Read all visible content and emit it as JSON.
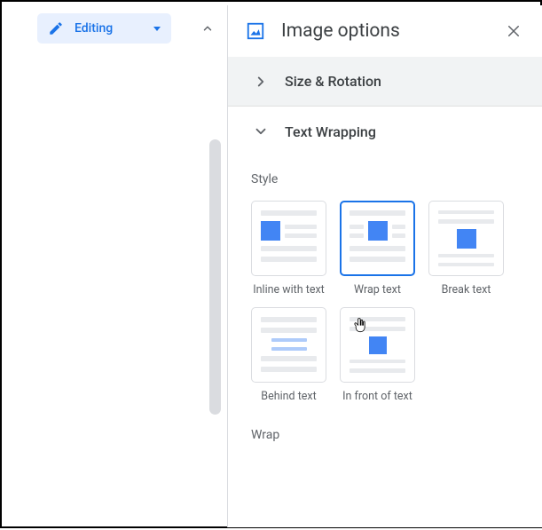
{
  "toolbar": {
    "editing_label": "Editing"
  },
  "panel": {
    "title": "Image options",
    "sections": {
      "size_rotation": "Size & Rotation",
      "text_wrapping": "Text Wrapping"
    },
    "style_label": "Style",
    "wrap_label": "Wrap",
    "options": {
      "inline": "Inline with text",
      "wrap": "Wrap text",
      "break": "Break text",
      "behind": "Behind text",
      "front": "In front of text"
    },
    "selected": "wrap"
  }
}
